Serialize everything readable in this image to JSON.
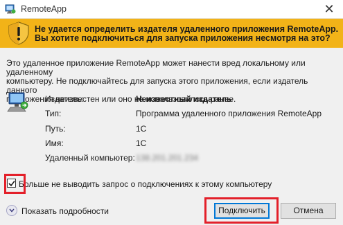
{
  "window": {
    "title": "RemoteApp",
    "close_glyph": "✕",
    "app_icon": "remoteapp-icon"
  },
  "warning": {
    "icon": "shield-warning-icon",
    "line1": "Не удается определить издателя удаленного приложения RemoteApp.",
    "line2": "Вы хотите подключиться для запуска приложения несмотря на это?",
    "color": "#f2b318"
  },
  "description": {
    "line1": "Это удаленное приложение RemoteApp может нанести вред локальному или удаленному",
    "line2": "компьютеру. Не подключайтесь для запуска этого приложения, если издатель данного",
    "line3": "приложения неизвестен или оно не использовалось ранее."
  },
  "details": {
    "icon": "remote-computer-icon",
    "rows": [
      {
        "label": "Издатель:",
        "value": "Неизвестный издатель"
      },
      {
        "label": "Тип:",
        "value": "Программа удаленного приложения RemoteApp"
      },
      {
        "label": "Путь:",
        "value": "1C"
      },
      {
        "label": "Имя:",
        "value": "1C"
      },
      {
        "label": "Удаленный компьютер:",
        "value": "138.201.201.234"
      }
    ]
  },
  "checkbox": {
    "label": "Больше не выводить запрос о подключениях к этому компьютеру",
    "checked": true
  },
  "footer": {
    "details_label": "Показать подробности",
    "connect_label": "Подключить",
    "cancel_label": "Отмена"
  },
  "highlight_color": "#e3202a"
}
